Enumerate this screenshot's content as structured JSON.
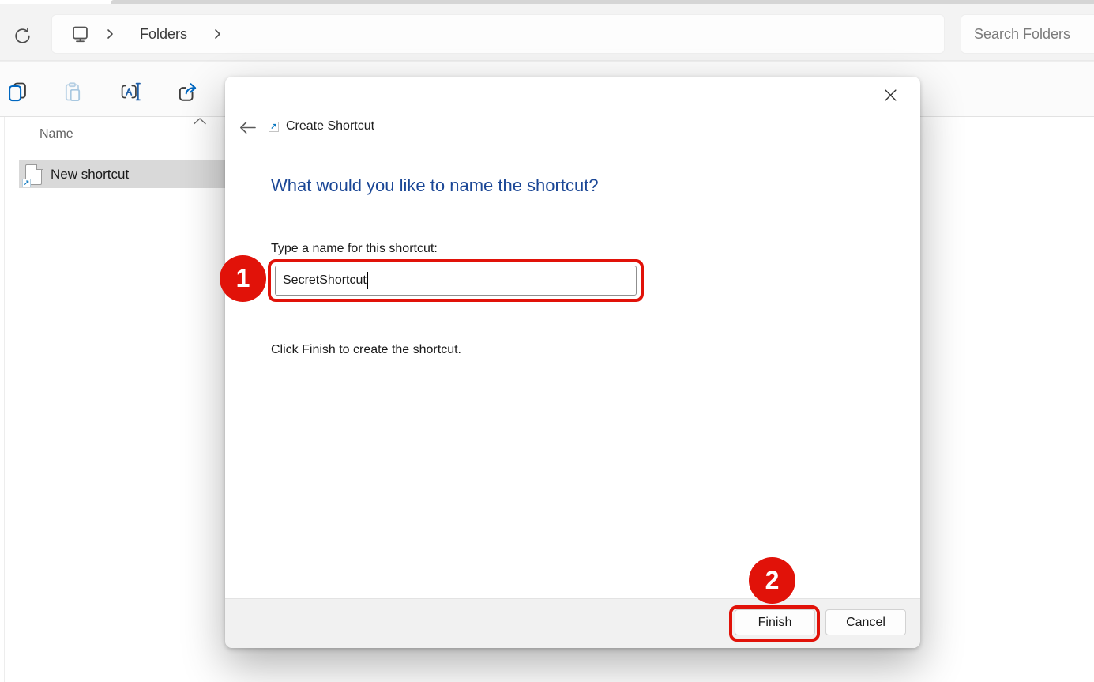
{
  "window": {
    "breadcrumb": {
      "folders": "Folders"
    },
    "search_placeholder": "Search Folders"
  },
  "file_pane": {
    "column_header": "Name",
    "rows": [
      {
        "name": "New shortcut"
      }
    ],
    "shortcut_badge_glyph": "↗",
    "selected_row_color": "#d9d9d9"
  },
  "dialog": {
    "title": "Create Shortcut",
    "title_icon_glyph": "↗",
    "heading": "What would you like to name the shortcut?",
    "field_label": "Type a name for this shortcut:",
    "field_value": "SecretShortcut",
    "hint": "Click Finish to create the shortcut.",
    "buttons": {
      "finish": "Finish",
      "cancel": "Cancel"
    }
  },
  "annotations": {
    "step_1": "1",
    "step_2": "2",
    "red": "#e11209"
  },
  "colors": {
    "heading_blue": "#1b4796",
    "accent_blue": "#0067c0"
  }
}
